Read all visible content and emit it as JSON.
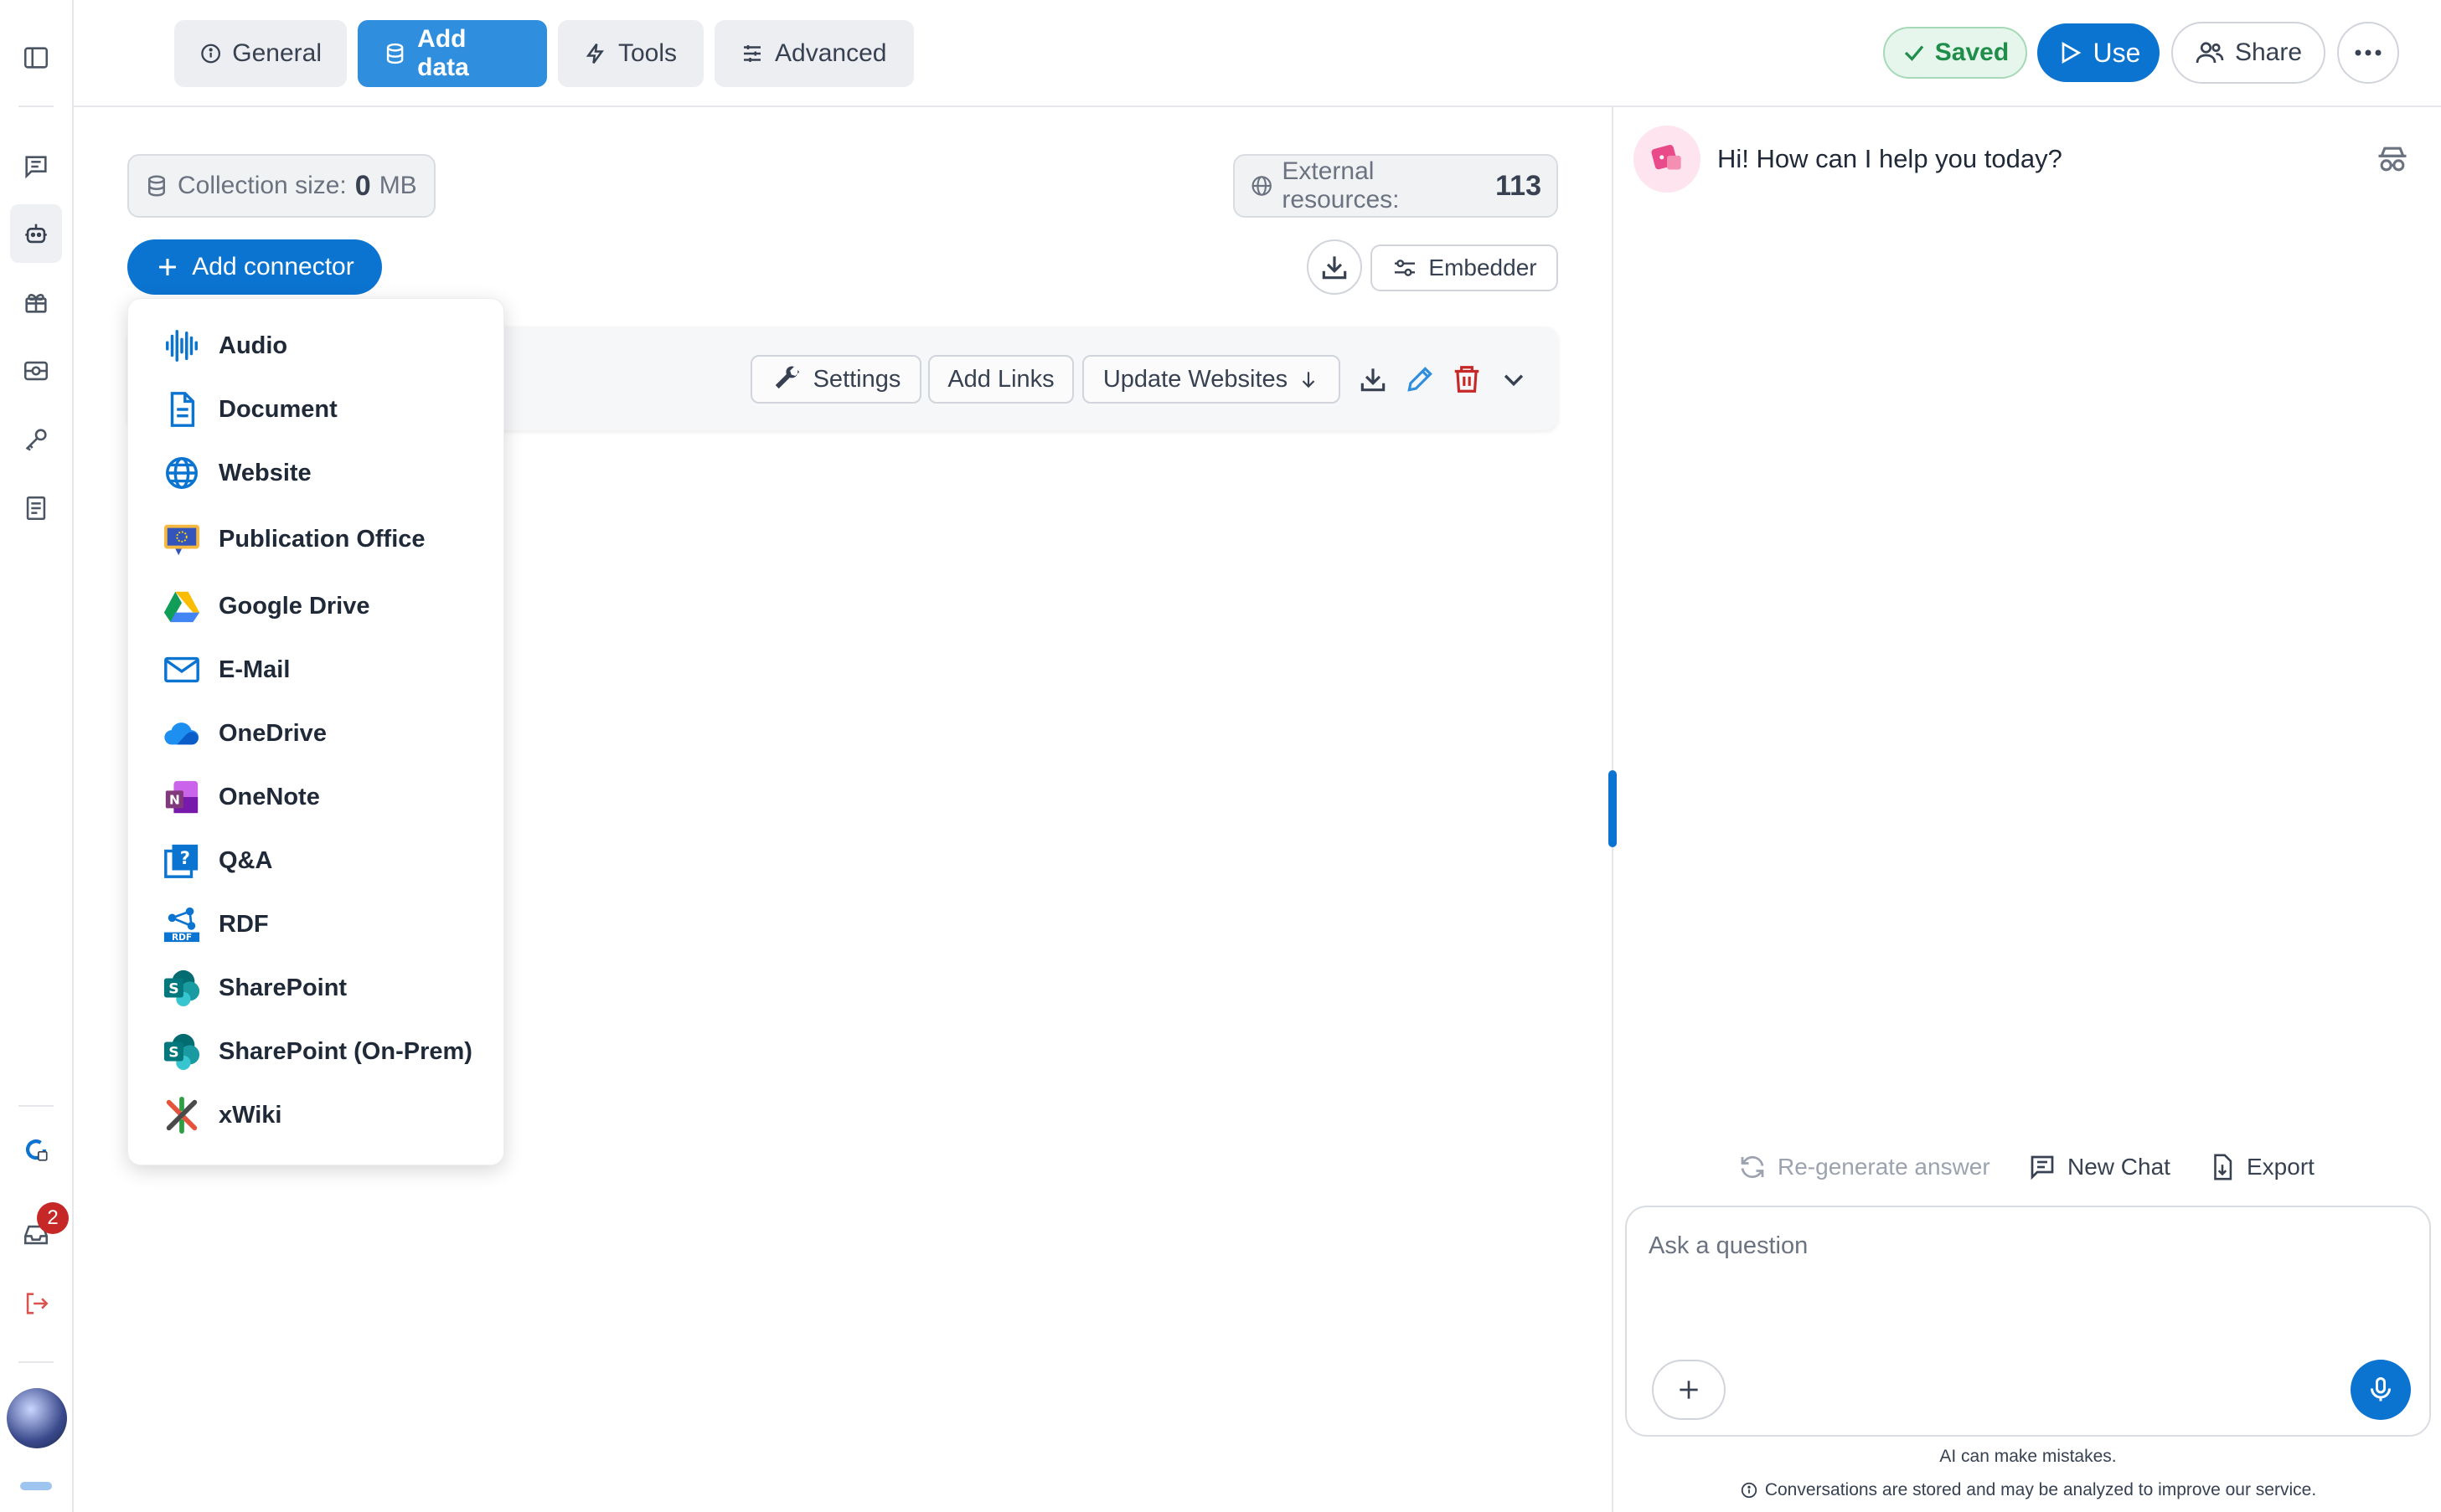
{
  "tabs": [
    {
      "label": "General",
      "icon": "info-icon"
    },
    {
      "label": "Add data",
      "icon": "database-icon",
      "active": true
    },
    {
      "label": "Tools",
      "icon": "bolt-icon"
    },
    {
      "label": "Advanced",
      "icon": "sliders-icon"
    }
  ],
  "header": {
    "saved_label": "Saved",
    "use_label": "Use",
    "share_label": "Share"
  },
  "sidebar": {
    "notification_count": "2"
  },
  "stats": {
    "collection_label": "Collection size:",
    "collection_value": "0",
    "collection_unit": "MB",
    "external_label": "External resources:",
    "external_value": "113"
  },
  "toolbar": {
    "add_connector_label": "Add connector",
    "embedder_label": "Embedder"
  },
  "connector_card": {
    "settings_label": "Settings",
    "add_links_label": "Add Links",
    "update_websites_label": "Update Websites"
  },
  "connector_menu": [
    {
      "label": "Audio",
      "icon": "audio-wave-icon"
    },
    {
      "label": "Document",
      "icon": "document-icon"
    },
    {
      "label": "Website",
      "icon": "globe-icon"
    },
    {
      "label": "Publication Office",
      "icon": "eu-publication-icon"
    },
    {
      "label": "Google Drive",
      "icon": "google-drive-icon"
    },
    {
      "label": "E-Mail",
      "icon": "mail-icon"
    },
    {
      "label": "OneDrive",
      "icon": "onedrive-icon"
    },
    {
      "label": "OneNote",
      "icon": "onenote-icon"
    },
    {
      "label": "Q&A",
      "icon": "qa-icon"
    },
    {
      "label": "RDF",
      "icon": "rdf-icon"
    },
    {
      "label": "SharePoint",
      "icon": "sharepoint-icon"
    },
    {
      "label": "SharePoint (On-Prem)",
      "icon": "sharepoint-icon"
    },
    {
      "label": "xWiki",
      "icon": "xwiki-icon"
    }
  ],
  "chat": {
    "greeting": "Hi! How can I help you today?",
    "regenerate_label": "Re-generate answer",
    "new_chat_label": "New Chat",
    "export_label": "Export",
    "input_placeholder": "Ask a question",
    "disclaimer": "AI can make mistakes.",
    "privacy_note": "Conversations are stored and may be analyzed to improve our service."
  },
  "colors": {
    "primary": "#0b74d1",
    "active_tab": "#2f8fde",
    "saved_green": "#1e8e4a",
    "danger": "#c62828"
  }
}
